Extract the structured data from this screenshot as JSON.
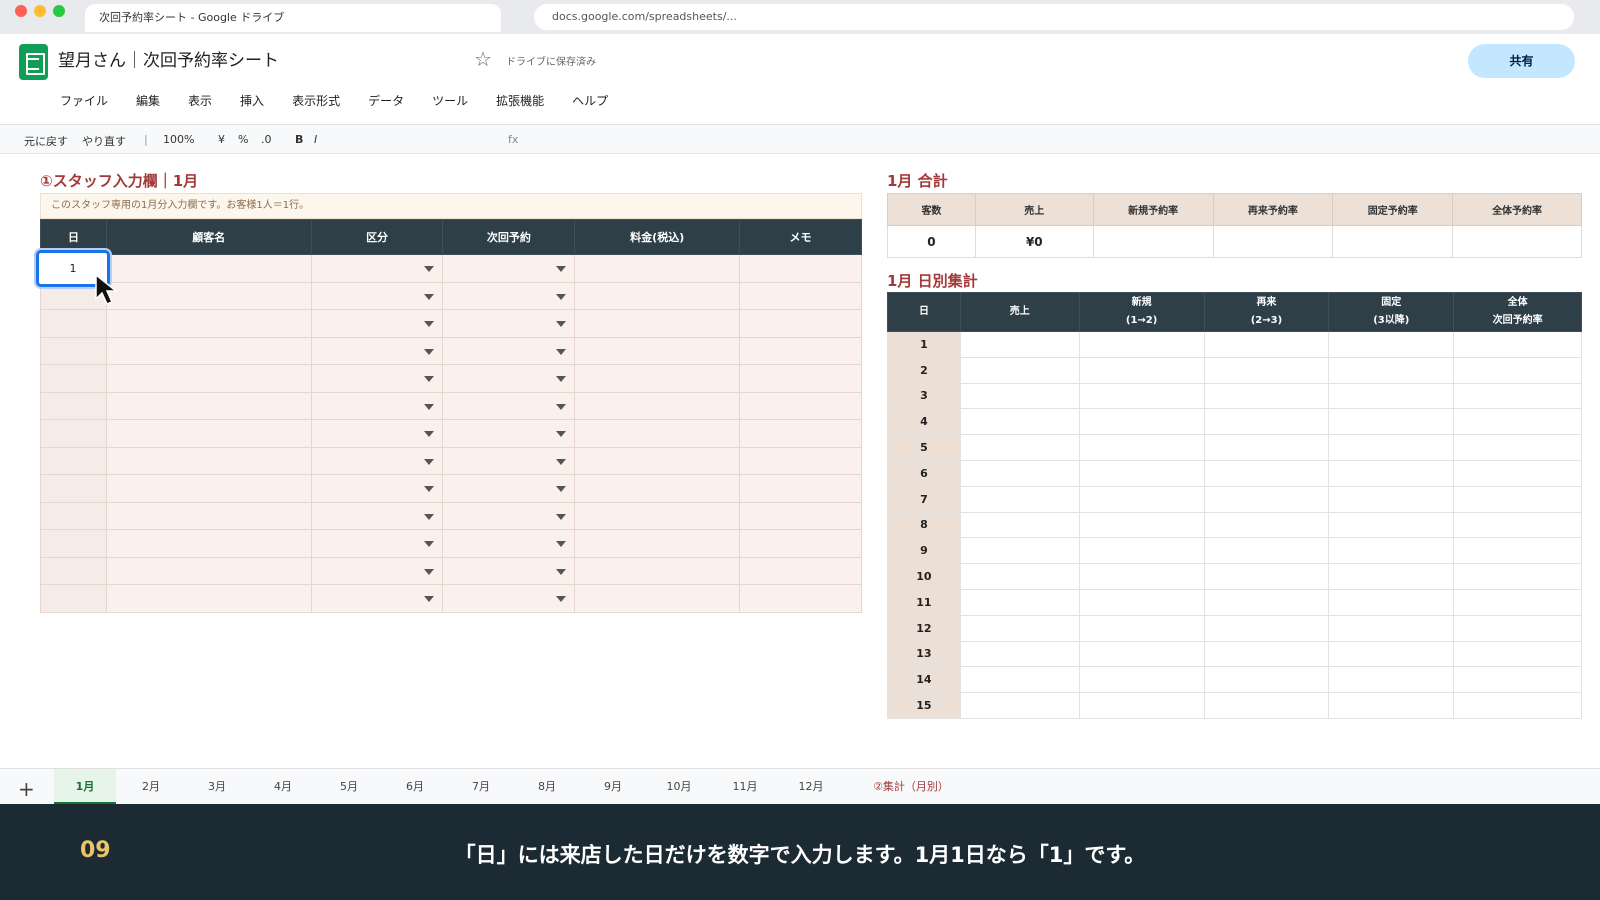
{
  "browser": {
    "tab_title": "次回予約率シート - Google ドライブ",
    "url": "docs.google.com/spreadsheets/..."
  },
  "header": {
    "doc_title": "望月さん｜次回予約率シート",
    "saved_status": "ドライブに保存済み",
    "share_label": "共有",
    "menu": [
      "ファイル",
      "編集",
      "表示",
      "挿入",
      "表示形式",
      "データ",
      "ツール",
      "拡張機能",
      "ヘルプ"
    ]
  },
  "toolbar": {
    "undo": "元に戻す",
    "redo": "やり直す",
    "sep": "|",
    "zoom": "100%",
    "currency": "¥",
    "percent": "%",
    "decimal": ".0",
    "bold": "B",
    "italic": "I",
    "fx": "fx"
  },
  "staff": {
    "title": "①スタッフ入力欄｜1月",
    "note": "このスタッフ専用の1月分入力欄です。お客様1人＝1行。",
    "headers": [
      "日",
      "顧客名",
      "区分",
      "次回予約",
      "料金(税込)",
      "メモ"
    ],
    "selected_value": "1",
    "row_count": 13
  },
  "total": {
    "title": "1月 合計",
    "headers": [
      "客数",
      "売上",
      "新規予約率",
      "再来予約率",
      "固定予約率",
      "全体予約率"
    ],
    "values": [
      "0",
      "¥0",
      "",
      "",
      "",
      ""
    ]
  },
  "daily": {
    "title": "1月 日別集計",
    "headers": [
      {
        "l1": "日",
        "l2": ""
      },
      {
        "l1": "売上",
        "l2": ""
      },
      {
        "l1": "新規",
        "l2": "(1→2)"
      },
      {
        "l1": "再来",
        "l2": "(2→3)"
      },
      {
        "l1": "固定",
        "l2": "(3以降)"
      },
      {
        "l1": "全体",
        "l2": "次回予約率"
      }
    ],
    "days": [
      "1",
      "2",
      "3",
      "4",
      "5",
      "6",
      "7",
      "8",
      "9",
      "10",
      "11",
      "12",
      "13",
      "14",
      "15"
    ]
  },
  "sheets": {
    "tabs": [
      "1月",
      "2月",
      "3月",
      "4月",
      "5月",
      "6月",
      "7月",
      "8月",
      "9月",
      "10月",
      "11月",
      "12月"
    ],
    "summary_tab": "②集計（月別）",
    "active": "1月"
  },
  "caption": {
    "step": "09",
    "text": "「日」には来店した日だけを数字で入力します。1月1日なら「1」です。"
  }
}
